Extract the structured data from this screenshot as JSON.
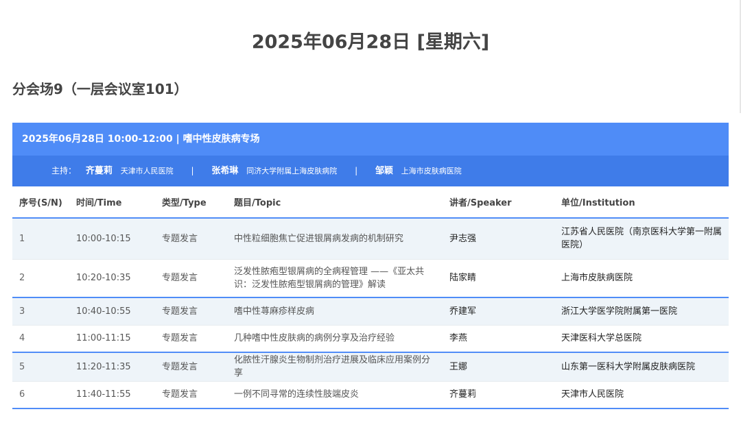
{
  "date_heading": "2025年06月28日 [星期六]",
  "venue_heading": "分会场9（一层会议室101）",
  "session": {
    "title": "2025年06月28日 10:00-12:00 | 嗜中性皮肤病专场",
    "hosts_label": "主持：",
    "hosts": [
      {
        "name": "齐蔓莉",
        "institution": "天津市人民医院"
      },
      {
        "name": "张希琳",
        "institution": "同济大学附属上海皮肤病院"
      },
      {
        "name": "邹颖",
        "institution": "上海市皮肤病医院"
      }
    ],
    "separator": "|"
  },
  "table": {
    "headers": {
      "sn": "序号(S/N)",
      "time": "时间/Time",
      "type": "类型/Type",
      "topic": "题目/Topic",
      "speaker": "讲者/Speaker",
      "institution": "单位/Institution"
    },
    "rows": [
      {
        "sn": "1",
        "time": "10:00-10:15",
        "type": "专题发言",
        "topic": "中性粒细胞焦亡促进银屑病发病的机制研究",
        "speaker": "尹志强",
        "institution": "江苏省人民医院（南京医科大学第一附属医院）"
      },
      {
        "sn": "2",
        "time": "10:20-10:35",
        "type": "专题发言",
        "topic": "泛发性脓疱型银屑病的全病程管理 ——《亚太共识：泛发性脓疱型银屑病的管理》解读",
        "speaker": "陆家睛",
        "institution": "上海市皮肤病医院"
      },
      {
        "sn": "3",
        "time": "10:40-10:55",
        "type": "专题发言",
        "topic": "嗜中性荨麻疹样皮病",
        "speaker": "乔建军",
        "institution": "浙江大学医学院附属第一医院"
      },
      {
        "sn": "4",
        "time": "11:00-11:15",
        "type": "专题发言",
        "topic": "几种嗜中性皮肤病的病例分享及治疗经验",
        "speaker": "李燕",
        "institution": "天津医科大学总医院"
      },
      {
        "sn": "5",
        "time": "11:20-11:35",
        "type": "专题发言",
        "topic": "化脓性汗腺炎生物制剂治疗进展及临床应用案例分享",
        "speaker": "王娜",
        "institution": "山东第一医科大学附属皮肤病医院"
      },
      {
        "sn": "6",
        "time": "11:40-11:55",
        "type": "专题发言",
        "topic": "一例不同寻常的连续性肢端皮炎",
        "speaker": "齐蔓莉",
        "institution": "天津市人民医院"
      }
    ]
  },
  "colors": {
    "accent": "#4f8cf7",
    "accent_dark": "#3f7ce9",
    "row_stripe": "#eef4f9"
  }
}
